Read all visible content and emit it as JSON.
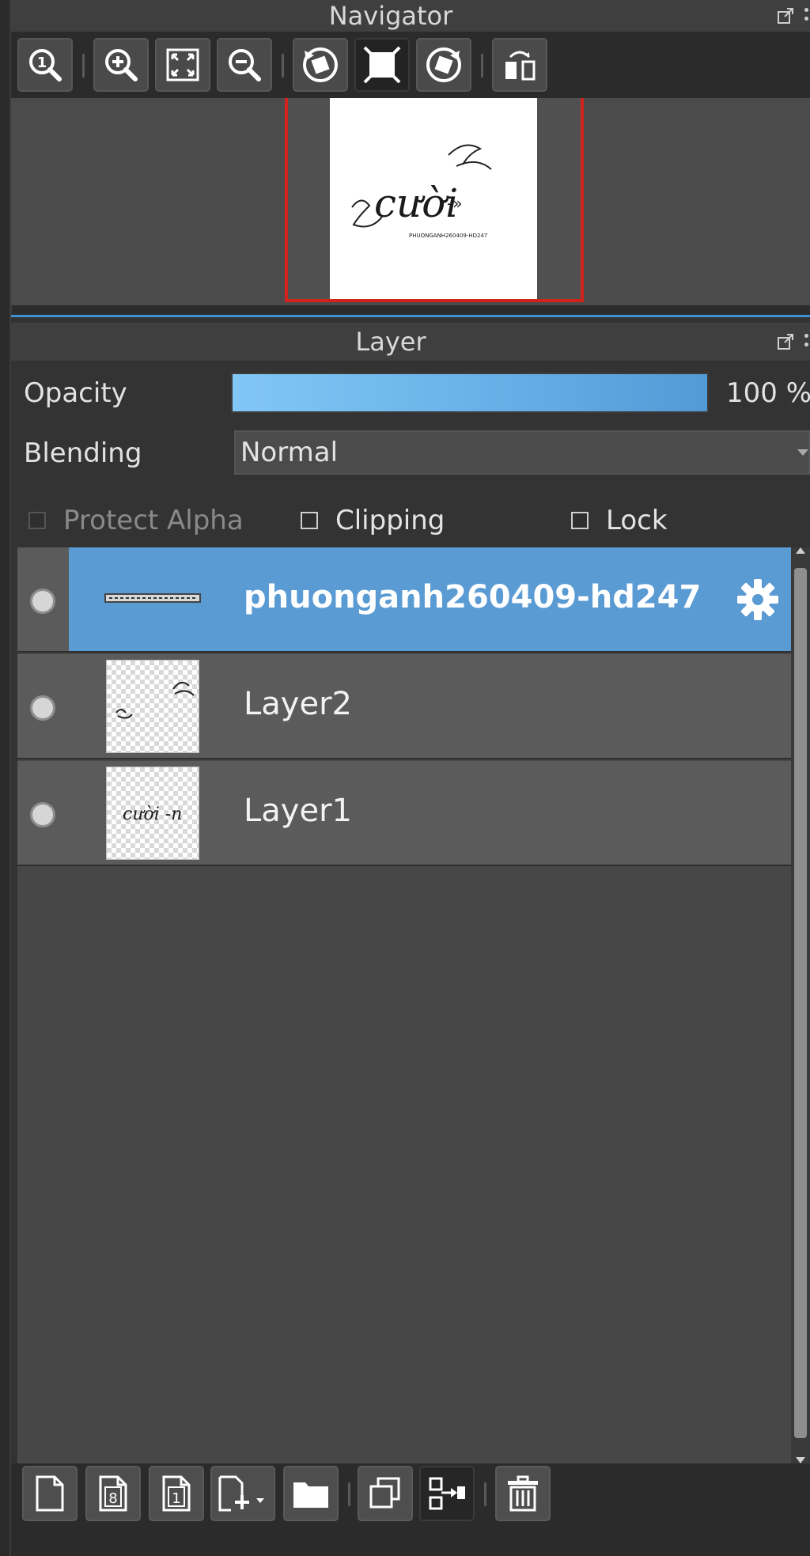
{
  "navigator": {
    "title": "Navigator",
    "toolbar": [
      {
        "name": "zoom-actual-size-icon"
      },
      {
        "name": "zoom-in-icon"
      },
      {
        "name": "fit-to-window-icon"
      },
      {
        "name": "zoom-out-icon"
      },
      {
        "name": "rotate-left-icon"
      },
      {
        "name": "reset-rotation-icon",
        "active": true
      },
      {
        "name": "rotate-right-icon"
      },
      {
        "name": "flip-horizontal-icon"
      }
    ],
    "preview": {
      "artwork_text": "cười",
      "artwork_caption": "PHUONGANH260409-HD247"
    }
  },
  "layer_panel": {
    "title": "Layer",
    "opacity_label": "Opacity",
    "opacity_value": "100 %",
    "opacity_fraction": 1.0,
    "blending_label": "Blending",
    "blending_value": "Normal",
    "protect_alpha_label": "Protect Alpha",
    "clipping_label": "Clipping",
    "lock_label": "Lock",
    "layers": [
      {
        "name": "phuonganh260409-hd247",
        "selected": true,
        "type": "text"
      },
      {
        "name": "Layer2",
        "selected": false,
        "type": "raster"
      },
      {
        "name": "Layer1",
        "selected": false,
        "type": "raster",
        "thumb_text": "cười -n"
      }
    ],
    "bottom_toolbar": [
      "new-layer-icon",
      "new-8bit-layer-icon",
      "new-1bit-layer-icon",
      "add-layer-menu-icon",
      "new-folder-icon",
      "duplicate-layer-icon",
      "merge-down-icon",
      "delete-layer-icon"
    ]
  },
  "colors": {
    "selection_blue": "#5a9bd4",
    "navigator_frame_red": "#d2221a",
    "panel_bg": "#333333"
  }
}
